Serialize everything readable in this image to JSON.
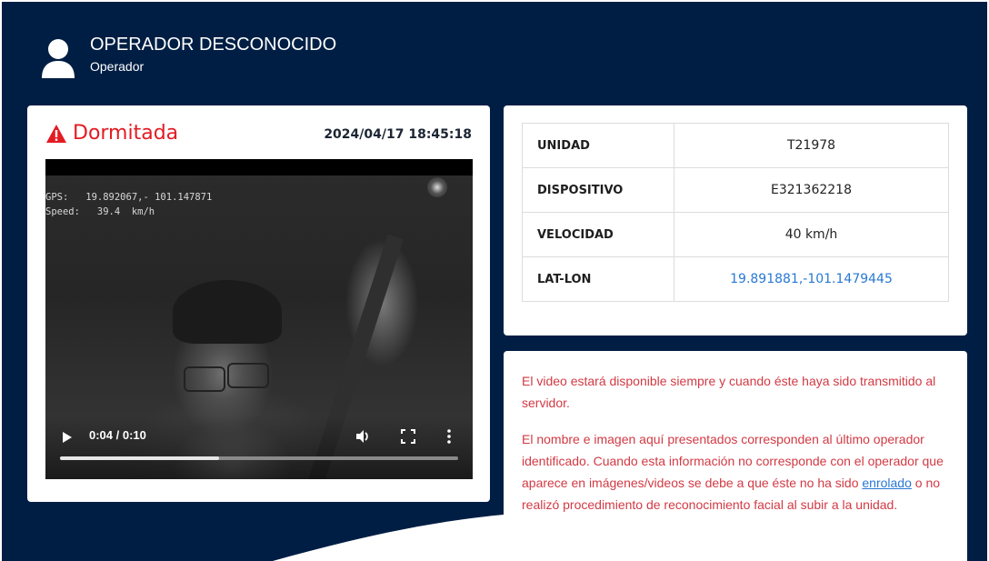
{
  "operator": {
    "name": "OPERADOR DESCONOCIDO",
    "role": "Operador"
  },
  "event": {
    "label": "Dormitada",
    "timestamp": "2024/04/17 18:45:18",
    "color": "#e31b23"
  },
  "video": {
    "overlay_gps": "GPS:   19.892067,- 101.147871",
    "overlay_speed": "Speed:   39.4  km/h",
    "time": "0:04 / 0:10",
    "progress_fraction": 0.4
  },
  "info": [
    {
      "label": "UNIDAD",
      "value": "T21978",
      "link": false
    },
    {
      "label": "DISPOSITIVO",
      "value": "E321362218",
      "link": false
    },
    {
      "label": "VELOCIDAD",
      "value": "40 km/h",
      "link": false
    },
    {
      "label": "LAT-LON",
      "value": "19.891881,-101.1479445",
      "link": true
    }
  ],
  "messages": {
    "p1": "El video estará disponible siempre y cuando éste haya sido transmitido al servidor.",
    "p2_before": "El nombre e imagen aquí presentados corresponden al último operador identificado. Cuando esta información no corresponde con el operador que aparece en imágenes/videos se debe a que éste no ha sido ",
    "p2_link": "enrolado",
    "p2_after": " o no realizó procedimiento de reconocimiento facial al subir a la unidad."
  },
  "colors": {
    "navy": "#001e44",
    "alert_red": "#e31b23",
    "message_red": "#d23a44",
    "link_blue": "#2878d4"
  },
  "icons": {
    "avatar": "user-icon",
    "warning": "warning-icon",
    "play": "play-icon",
    "volume": "volume-icon",
    "fullscreen": "fullscreen-icon",
    "more": "more-vertical-icon"
  }
}
